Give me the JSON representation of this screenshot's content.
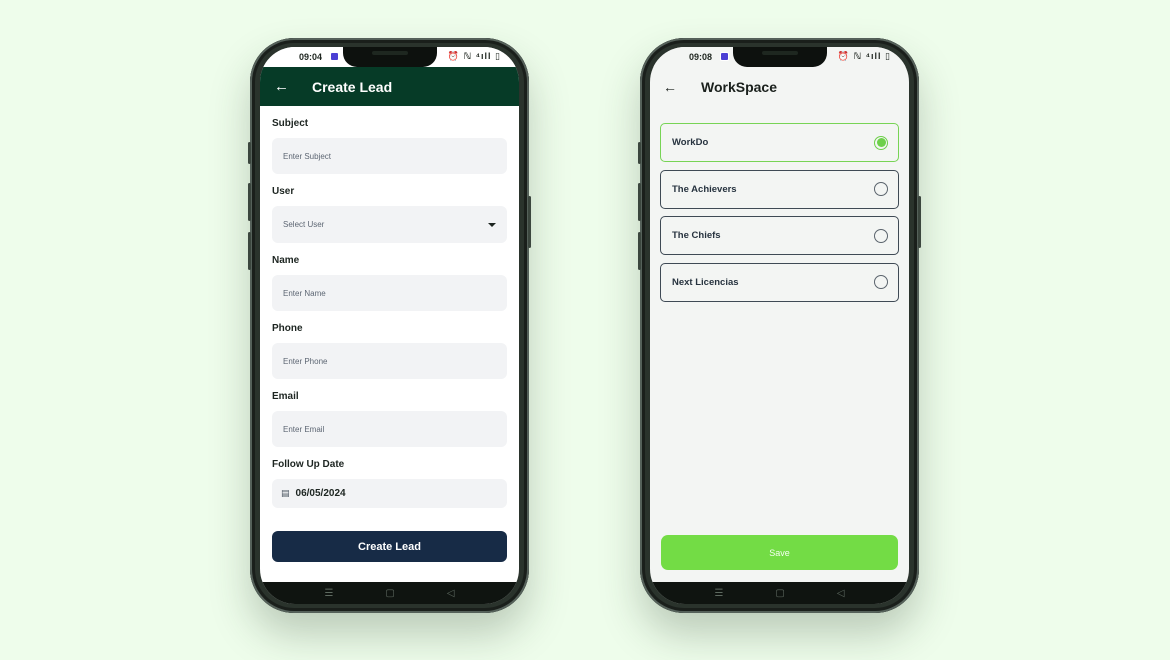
{
  "create_lead": {
    "status_time": "09:04",
    "status_icons": "⏰ ℕ ⁴ıll ▯",
    "header": {
      "title": "Create Lead"
    },
    "fields": [
      {
        "label": "Subject",
        "placeholder": "Enter Subject"
      },
      {
        "label": "User",
        "placeholder": "Select User"
      },
      {
        "label": "Name",
        "placeholder": "Enter Name"
      },
      {
        "label": "Phone",
        "placeholder": "Enter Phone"
      },
      {
        "label": "Email",
        "placeholder": "Enter Email"
      }
    ],
    "follow_up": {
      "label": "Follow Up Date",
      "value": "06/05/2024"
    },
    "submit_label": "Create Lead"
  },
  "workspace": {
    "status_time": "09:08",
    "status_icons": "⏰ ℕ ⁴ıll ▯",
    "header": {
      "title": "WorkSpace"
    },
    "items": [
      {
        "label": "WorkDo",
        "selected": true
      },
      {
        "label": "The Achievers",
        "selected": false
      },
      {
        "label": "The Chiefs",
        "selected": false
      },
      {
        "label": "Next Licencias",
        "selected": false
      }
    ],
    "save_label": "Save"
  },
  "colors": {
    "page_bg": "#eefdeb",
    "header_green": "#063b27",
    "button_dark": "#172b46",
    "accent_green": "#73dc45"
  },
  "icons": {
    "back": "arrow-left-icon",
    "dropdown": "caret-down-icon",
    "calendar": "calendar-icon",
    "radio": "radio-icon"
  }
}
